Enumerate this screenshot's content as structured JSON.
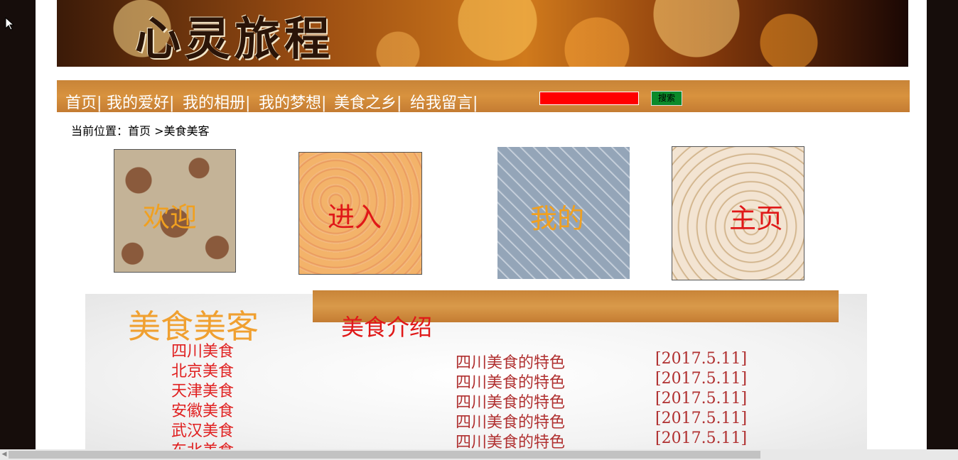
{
  "banner": {
    "title": "心灵旅程"
  },
  "nav": {
    "items": [
      "首页|",
      "我的爱好|",
      "我的相册|",
      "我的梦想|",
      "美食之乡|",
      "给我留言|"
    ],
    "search_button": "搜索"
  },
  "breadcrumb": "当前位置：首页 >美食美客",
  "tiles": [
    {
      "label": "欢迎",
      "color": "#f0a020"
    },
    {
      "label": "进入",
      "color": "#e01818"
    },
    {
      "label": "我的",
      "color": "#f0a020"
    },
    {
      "label": "主页",
      "color": "#e01818"
    }
  ],
  "sidebar": {
    "title": "美食美客",
    "items": [
      "四川美食",
      "北京美食",
      "天津美食",
      "安徽美食",
      "武汉美食",
      "东北美食"
    ]
  },
  "section": {
    "title": "美食介绍"
  },
  "news": [
    {
      "title": "四川美食的特色",
      "date": "[2017.5.11]"
    },
    {
      "title": "四川美食的特色",
      "date": "[2017.5.11]"
    },
    {
      "title": "四川美食的特色",
      "date": "[2017.5.11]"
    },
    {
      "title": "四川美食的特色",
      "date": "[2017.5.11]"
    },
    {
      "title": "四川美食的特色",
      "date": "[2017.5.11]"
    }
  ],
  "colors": {
    "nav_bg": "#d08a3a",
    "search_input": "#ff0000",
    "search_button": "#0b8a2a"
  }
}
